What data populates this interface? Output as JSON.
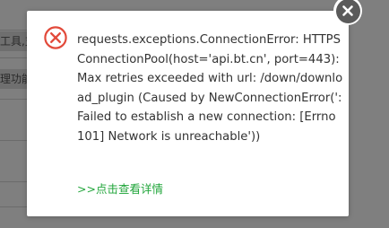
{
  "background": {
    "fragments": [
      "工具,支",
      "理功能"
    ]
  },
  "dialog": {
    "icon": "error-circle-x-icon",
    "message": "requests.exceptions.ConnectionError: HTTPSConnectionPool(host='api.bt.cn', port=443): Max retries exceeded with url: /down/download_plugin (Caused by NewConnectionError(': Failed to establish a new connection: [Errno 101] Network is unreachable'))",
    "details_link": ">>点击查看详情",
    "close_icon": "close-icon"
  },
  "colors": {
    "overlay": "#7f7f7f",
    "error_red": "#e24a3b",
    "link_green": "#20a53a",
    "text": "#333333",
    "close_bg": "#5a5a5a"
  }
}
